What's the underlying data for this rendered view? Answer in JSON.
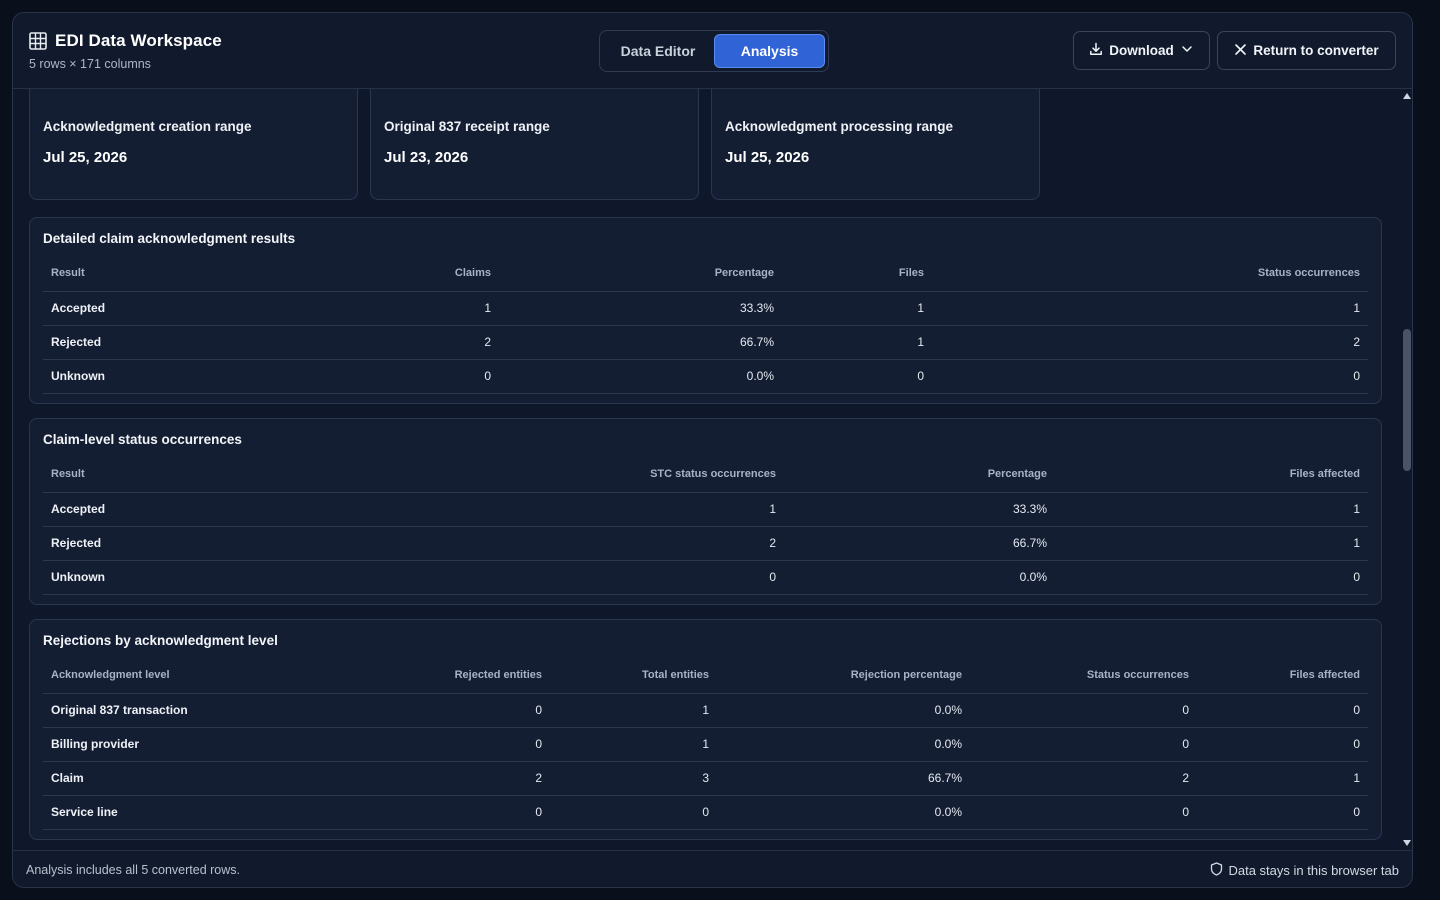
{
  "header": {
    "title": "EDI Data Workspace",
    "subtitle": "5 rows × 171 columns",
    "tabs": [
      "Data Editor",
      "Analysis"
    ],
    "active_tab": "Analysis",
    "download_label": "Download",
    "return_label": "Return to converter"
  },
  "stats": [
    {
      "label": "Acknowledgment creation range",
      "value": "Jul 25, 2026"
    },
    {
      "label": "Original 837 receipt range",
      "value": "Jul 23, 2026"
    },
    {
      "label": "Acknowledgment processing range",
      "value": "Jul 25, 2026"
    }
  ],
  "detailed": {
    "title": "Detailed claim acknowledgment results",
    "columns": [
      "Result",
      "Claims",
      "Percentage",
      "Files",
      "Status occurrences"
    ],
    "rows": [
      [
        "Accepted",
        "1",
        "33.3%",
        "1",
        "1"
      ],
      [
        "Rejected",
        "2",
        "66.7%",
        "1",
        "2"
      ],
      [
        "Unknown",
        "0",
        "0.0%",
        "0",
        "0"
      ]
    ]
  },
  "claim_level": {
    "title": "Claim-level status occurrences",
    "columns": [
      "Result",
      "STC status occurrences",
      "Percentage",
      "Files affected"
    ],
    "rows": [
      [
        "Accepted",
        "1",
        "33.3%",
        "1"
      ],
      [
        "Rejected",
        "2",
        "66.7%",
        "1"
      ],
      [
        "Unknown",
        "0",
        "0.0%",
        "0"
      ]
    ]
  },
  "rejections": {
    "title": "Rejections by acknowledgment level",
    "columns": [
      "Acknowledgment level",
      "Rejected entities",
      "Total entities",
      "Rejection percentage",
      "Status occurrences",
      "Files affected"
    ],
    "rows": [
      [
        "Original 837 transaction",
        "0",
        "1",
        "0.0%",
        "0",
        "0"
      ],
      [
        "Billing provider",
        "0",
        "1",
        "0.0%",
        "0",
        "0"
      ],
      [
        "Claim",
        "2",
        "3",
        "66.7%",
        "2",
        "1"
      ],
      [
        "Service line",
        "0",
        "0",
        "0.0%",
        "0",
        "0"
      ]
    ]
  },
  "footer": {
    "left": "Analysis includes all 5 converted rows.",
    "right": "Data stays in this browser tab"
  },
  "colors": {
    "accent": "#2f63d6",
    "background": "#0f172a",
    "panel": "#141e33"
  }
}
